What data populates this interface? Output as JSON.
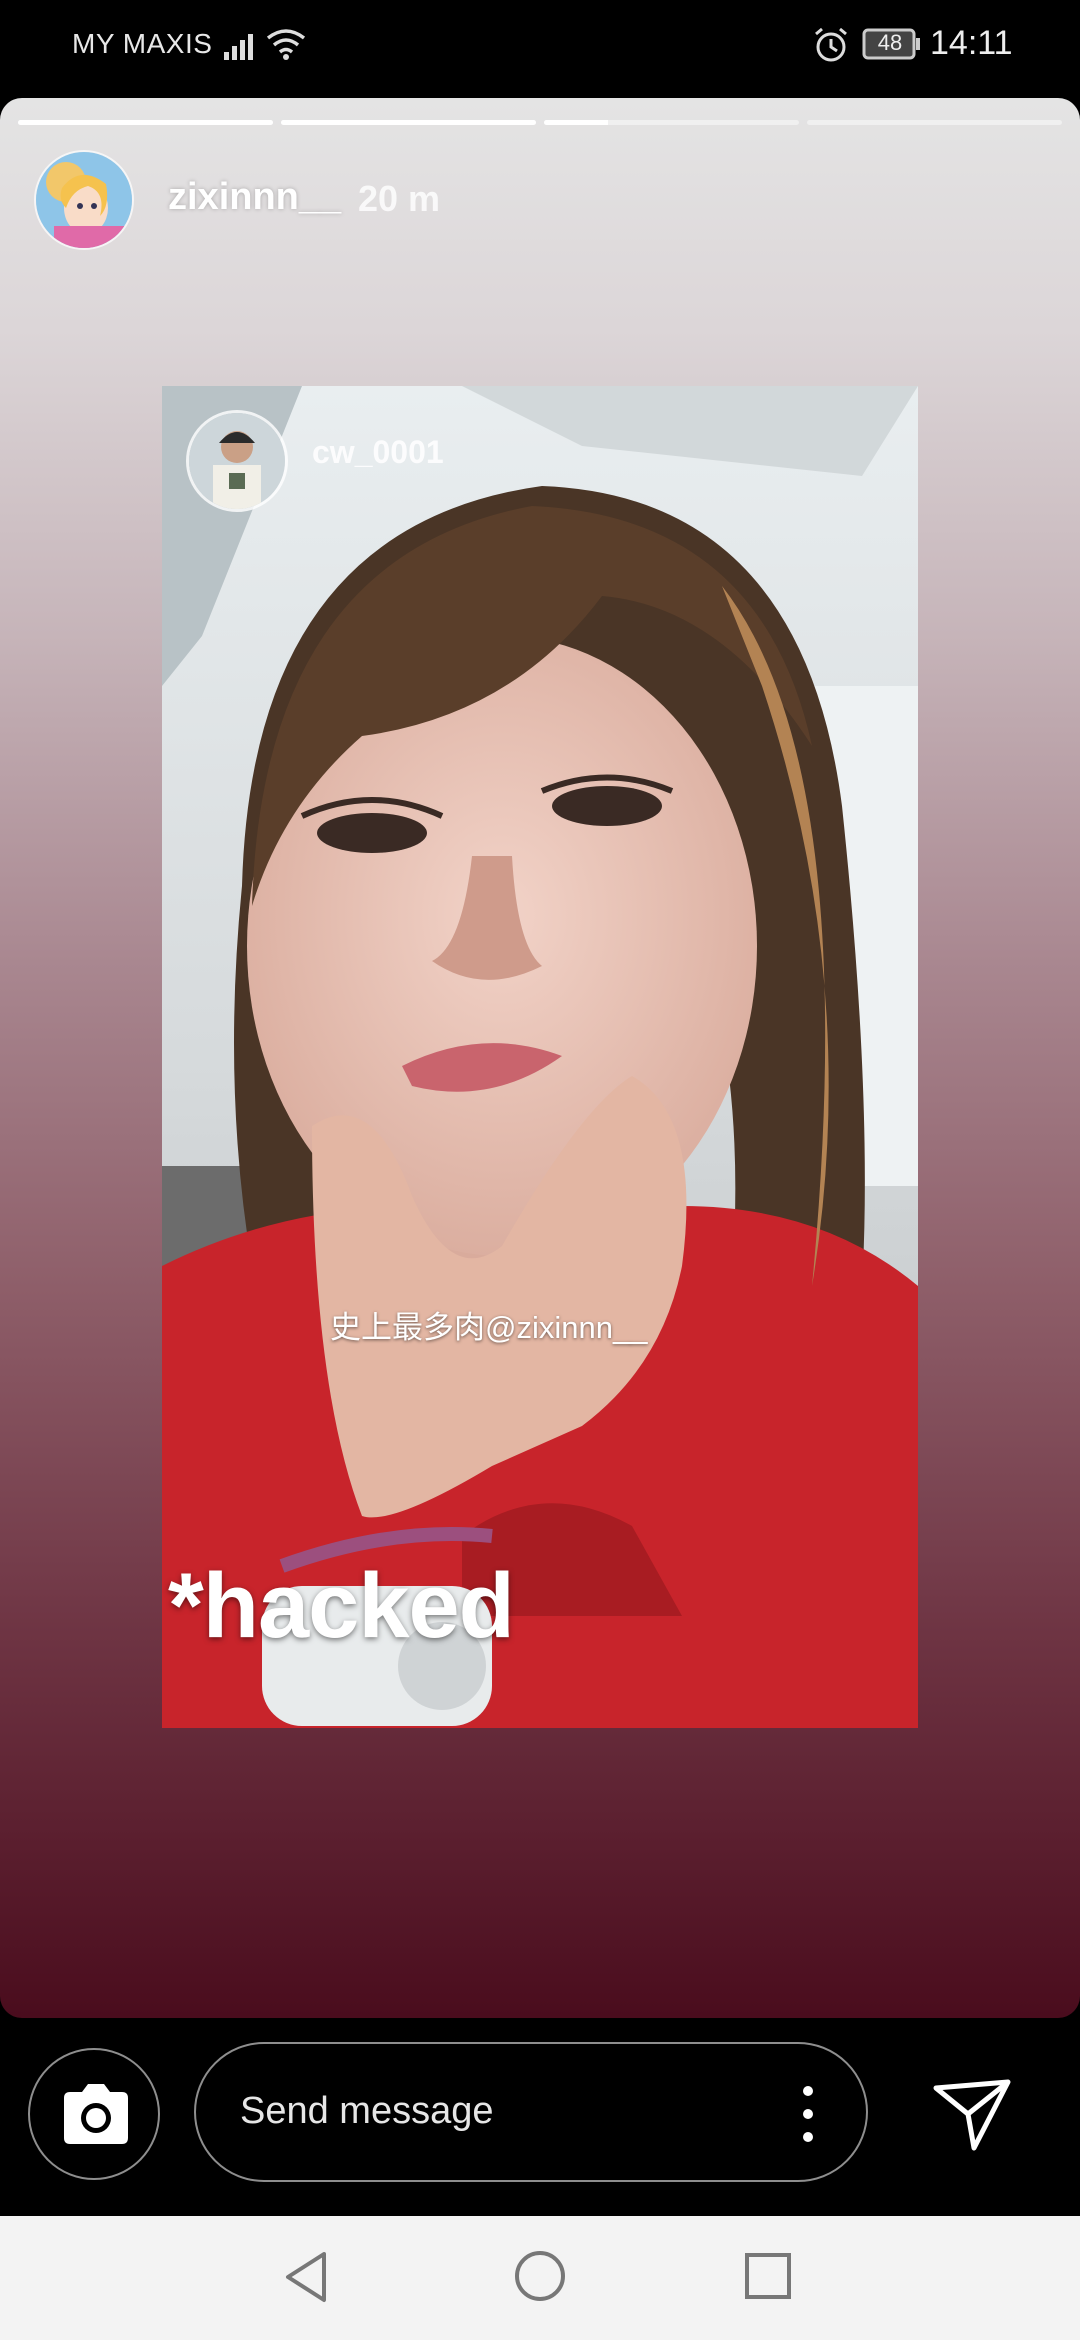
{
  "status_bar": {
    "carrier": "MY MAXIS",
    "battery": "48",
    "time": "14:11",
    "icons": [
      "signal-icon",
      "wifi-icon",
      "alarm-icon",
      "battery-icon"
    ]
  },
  "story": {
    "username": "zixinnn__",
    "time_ago": "20 m",
    "progress_segments": [
      1.0,
      1.0,
      0.25,
      0.0
    ],
    "reposted": {
      "username": "cw_0001",
      "mention_text": "史上最多肉@zixinnn__",
      "caption": "*hacked"
    }
  },
  "reply_bar": {
    "placeholder": "Send message",
    "icons": [
      "camera-icon",
      "more-vertical-icon",
      "send-icon"
    ]
  },
  "nav_bar": {
    "icons": [
      "back-icon",
      "home-icon",
      "recents-icon"
    ]
  },
  "colors": {
    "story_top": "#e4e4e4",
    "story_bottom": "#4a0c1d",
    "shirt_red": "#c8242b",
    "nav_bg": "#f3f3f3"
  }
}
